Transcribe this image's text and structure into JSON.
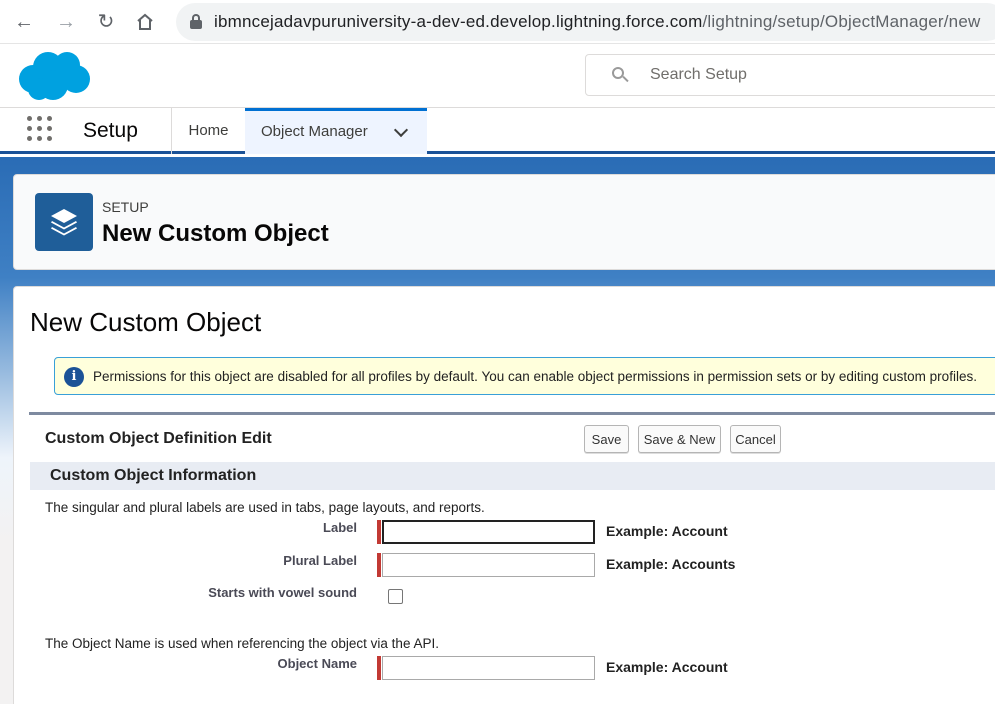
{
  "browser": {
    "url_host": "ibmncejadavpuruniversity-a-dev-ed.develop.lightning.force.com",
    "url_path": "/lightning/setup/ObjectManager/new"
  },
  "header": {
    "logo": "salesforce-cloud-logo",
    "search_placeholder": "Search Setup"
  },
  "context_bar": {
    "app_name": "Setup",
    "tabs": [
      {
        "label": "Home"
      },
      {
        "label": "Object Manager"
      }
    ]
  },
  "setup_header": {
    "eyebrow": "SETUP",
    "title": "New Custom Object"
  },
  "page": {
    "title": "New Custom Object",
    "info_message": "Permissions for this object are disabled for all profiles by default. You can enable object permissions in permission sets or by editing custom profiles."
  },
  "block": {
    "title": "Custom Object Definition Edit",
    "buttons": {
      "save": "Save",
      "save_new": "Save & New",
      "cancel": "Cancel"
    }
  },
  "section": {
    "title": "Custom Object Information",
    "labels_help": "The singular and plural labels are used in tabs, page layouts, and reports.",
    "api_help": "The Object Name is used when referencing the object via the API.",
    "fields": {
      "label": {
        "label": "Label",
        "value": "",
        "example": "Example:  Account"
      },
      "plural_label": {
        "label": "Plural Label",
        "value": "",
        "example": "Example:  Accounts"
      },
      "vowel": {
        "label": "Starts with vowel sound",
        "checked": false
      },
      "object_name": {
        "label": "Object Name",
        "value": "",
        "example": "Example:  Account"
      }
    }
  },
  "colors": {
    "brand_blue": "#1b5297",
    "salesforce_cloud": "#00a1e0",
    "required": "#c23934"
  }
}
